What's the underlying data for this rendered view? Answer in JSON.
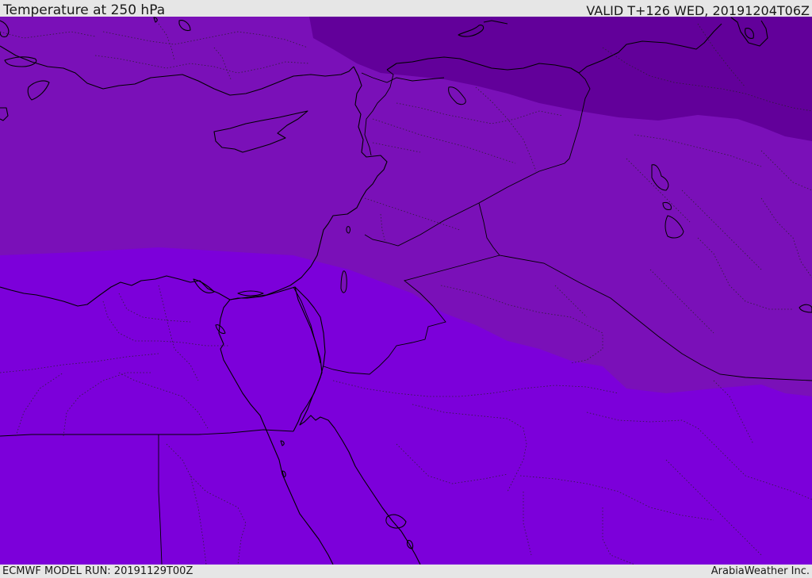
{
  "header": {
    "title": "Temperature at 250 hPa",
    "valid_time": "VALID T+126 WED, 20191204T06Z"
  },
  "footer": {
    "model_run": "ECMWF MODEL RUN: 20191129T00Z",
    "credit": "ArabiaWeather Inc."
  },
  "colors": {
    "coldest_band": "#62009a",
    "cold_band": "#7a10b8",
    "mild_band": "#7c00da",
    "sea_water": "#7a14b4",
    "background": "#e6e6e6"
  }
}
